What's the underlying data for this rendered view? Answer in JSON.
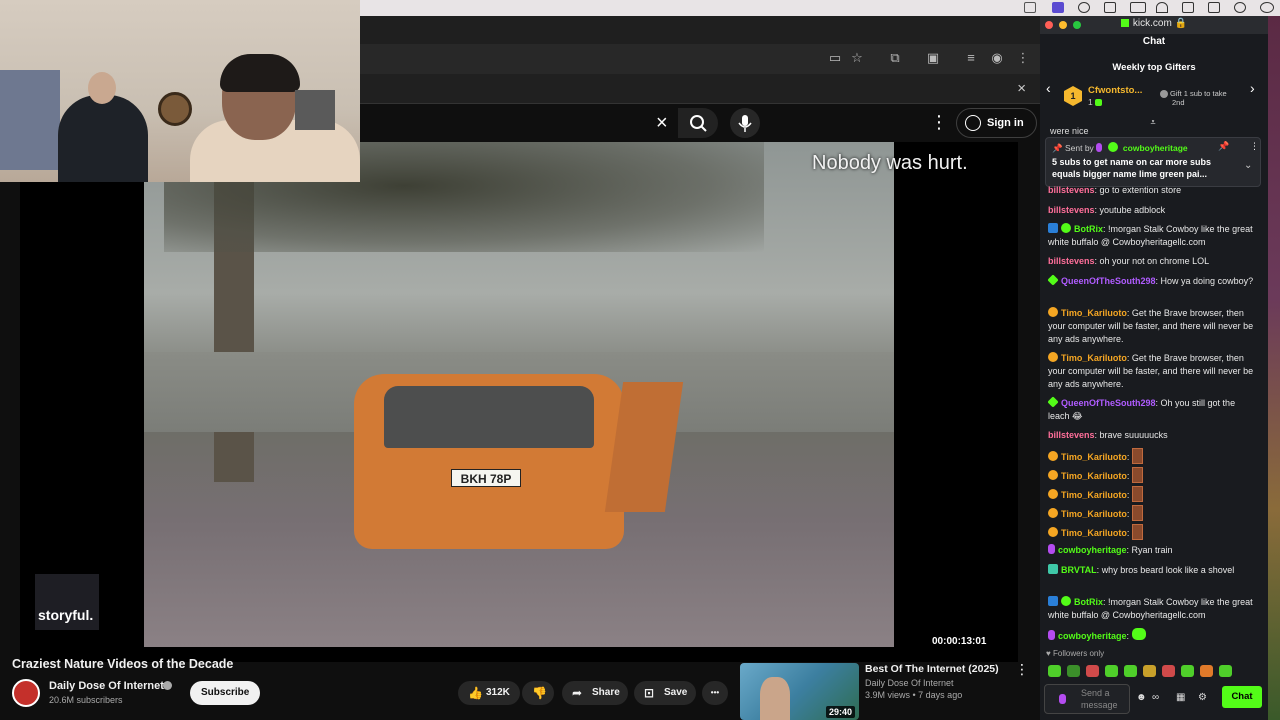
{
  "browser": {
    "search": {
      "close_icon": "×"
    },
    "signin_label": "Sign in",
    "infobar_close": "×",
    "menu_icon": "⋮"
  },
  "video": {
    "caption": "Nobody was hurt.",
    "watermark": "storyful.",
    "timecode": "00:00:13:01",
    "plate": "BKH 78P",
    "title": "Craziest Nature Videos of the Decade"
  },
  "channel": {
    "name": "Daily Dose Of Internet",
    "subscribers": "20.6M subscribers",
    "subscribe_label": "Subscribe"
  },
  "actions": {
    "likes": "312K",
    "share": "Share",
    "save": "Save",
    "more": "•••"
  },
  "recommended": {
    "title": "Best Of The Internet (2025)",
    "channel": "Daily Dose Of Internet",
    "meta": "3.9M views • 7 days ago",
    "duration": "29:40"
  },
  "kick": {
    "url": "kick.com",
    "header": "Chat",
    "gifters": {
      "title": "Weekly top Gifters",
      "rank": "1",
      "name": "Cfwontsto...",
      "count": "1",
      "next_line1": "Gift 1 sub to take",
      "next_line2": "2nd"
    },
    "behind_text": "were nice",
    "pinned": {
      "sent_by": "Sent by",
      "user": "cowboyheritage",
      "text": "5 subs to get name on car more subs equals bigger name lime green pai..."
    },
    "messages": [
      {
        "user": "billstevens",
        "color": "#ff6f9a",
        "text": "go to extention store"
      },
      {
        "user": "billstevens",
        "color": "#ff6f9a",
        "text": "youtube adblock"
      },
      {
        "user": "BotRix",
        "color": "#53fc18",
        "text": "!morgan Stalk Cowboy like the great white buffalo @ Cowboyheritagellc.com"
      },
      {
        "user": "billstevens",
        "color": "#ff6f9a",
        "text": "oh your not on chrome LOL"
      },
      {
        "user": "QueenOfTheSouth298",
        "color": "#b05cff",
        "text": "How ya doing cowboy?"
      },
      {
        "user": "Timo_Kariluoto",
        "color": "#f5a623",
        "text": "Get the Brave browser, then your computer will be faster, and there will never be any ads anywhere."
      },
      {
        "user": "Timo_Kariluoto",
        "color": "#f5a623",
        "text": "Get the Brave browser, then your computer will be faster, and there will never be any ads anywhere."
      },
      {
        "user": "QueenOfTheSouth298",
        "color": "#b05cff",
        "text": "Oh you still got the leach 😂"
      },
      {
        "user": "billstevens",
        "color": "#ff6f9a",
        "text": "brave suuuuucks"
      },
      {
        "user": "Timo_Kariluoto",
        "color": "#f5a623",
        "text": ":"
      },
      {
        "user": "Timo_Kariluoto",
        "color": "#f5a623",
        "text": ":"
      },
      {
        "user": "Timo_Kariluoto",
        "color": "#f5a623",
        "text": ":"
      },
      {
        "user": "Timo_Kariluoto",
        "color": "#f5a623",
        "text": ":"
      },
      {
        "user": "Timo_Kariluoto",
        "color": "#f5a623",
        "text": ":"
      },
      {
        "user": "cowboyheritage",
        "color": "#53fc18",
        "text": "Ryan train"
      },
      {
        "user": "BRVTAL",
        "color": "#53fc18",
        "text": "why bros beard look like a shovel"
      },
      {
        "user": "BotRix",
        "color": "#53fc18",
        "text": "!morgan Stalk Cowboy like the great white buffalo @ Cowboyheritagellc.com"
      },
      {
        "user": "cowboyheritage",
        "color": "#53fc18",
        "text": ":"
      }
    ],
    "followers_only": "Followers only",
    "input_placeholder": "Send a message",
    "send_label": "Chat"
  },
  "colors": {
    "kick_green": "#53fc18",
    "yt_red": "#c4302b",
    "gifter_gold": "#f5b82e"
  }
}
